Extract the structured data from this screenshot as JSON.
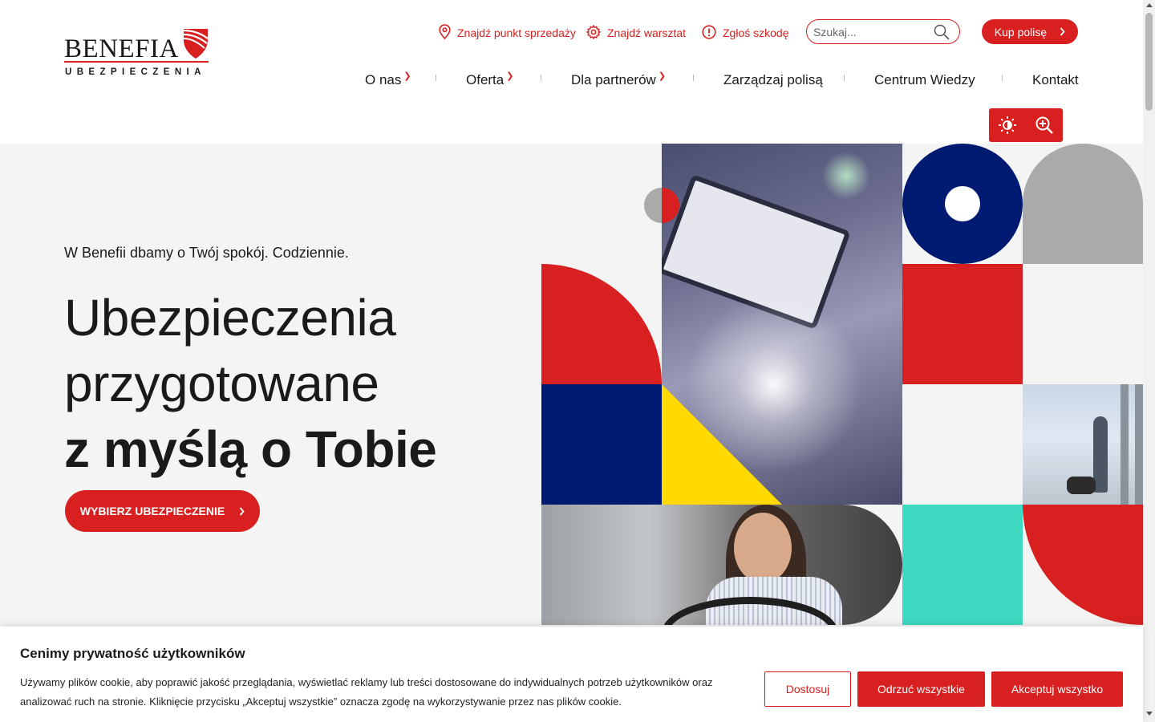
{
  "logo": {
    "name": "BENEFIA",
    "sub": "UBEZPIECZENIA",
    "brand_color": "#d7201f"
  },
  "utility": {
    "find_point": {
      "label": "Znajdź punkt sprzedaży",
      "icon": "map-pin-icon"
    },
    "find_workshop": {
      "label": "Znajdź warsztat",
      "icon": "gear-icon"
    },
    "report_claim": {
      "label": "Zgłoś szkodę",
      "icon": "alert-circle-icon"
    },
    "search": {
      "placeholder": "Szukaj...",
      "value": "",
      "icon": "search-icon"
    },
    "buy": {
      "label": "Kup polisę",
      "icon": "chevron-right-icon"
    }
  },
  "nav": [
    {
      "label": "O nas",
      "dropdown": true
    },
    {
      "label": "Oferta",
      "dropdown": true
    },
    {
      "label": "Dla partnerów",
      "dropdown": true
    },
    {
      "label": "Zarządzaj polisą",
      "dropdown": false
    },
    {
      "label": "Centrum Wiedzy",
      "dropdown": false
    },
    {
      "label": "Kontakt",
      "dropdown": false
    }
  ],
  "accessibility": {
    "contrast_icon": "sun-icon",
    "zoom_icon": "zoom-in-icon"
  },
  "hero": {
    "subtitle": "W Benefii dbamy o Twój spokój. Codziennie.",
    "title_line1": "Ubezpieczenia",
    "title_line2": "przygotowane",
    "title_line3": "z myślą o Tobie",
    "cta": "WYBIERZ UBEZPIECZENIE"
  },
  "cookie": {
    "title": "Cenimy prywatność użytkowników",
    "text_line1": "Używamy plików cookie, aby poprawić jakość przeglądania, wyświetlać reklamy lub treści dostosowane do indywidualnych potrzeb użytkowników oraz",
    "text_line2": "analizować ruch na stronie. Kliknięcie przycisku „Akceptuj wszystkie” oznacza zgodę na wykorzystywanie przez nas plików cookie.",
    "customize": "Dostosuj",
    "reject": "Odrzuć wszystkie",
    "accept": "Akceptuj wszystko"
  },
  "colors": {
    "red": "#d7201f",
    "navy": "#001a72",
    "yellow": "#ffd900",
    "grey": "#aaaaaa",
    "teal": "#3dd9c1",
    "hero_bg": "#f4f4f4"
  }
}
